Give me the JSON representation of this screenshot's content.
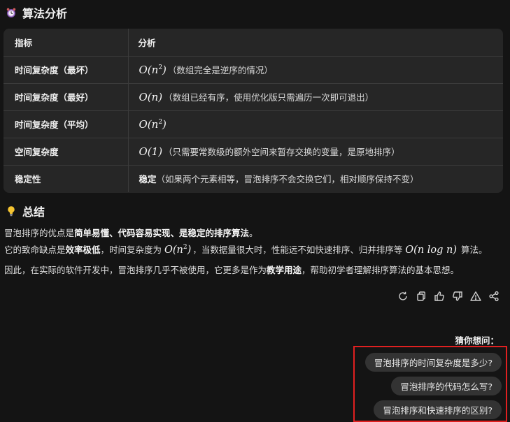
{
  "analysis": {
    "title": "算法分析",
    "table": {
      "headers": [
        "指标",
        "分析"
      ],
      "rows": [
        {
          "metric": "时间复杂度（最坏）",
          "math": "O(n",
          "sup": "2",
          "math_end": ")",
          "bold": "",
          "desc": "（数组完全是逆序的情况）"
        },
        {
          "metric": "时间复杂度（最好）",
          "math": "O(n)",
          "sup": "",
          "math_end": "",
          "bold": "",
          "desc": "（数组已经有序，使用优化版只需遍历一次即可退出）"
        },
        {
          "metric": "时间复杂度（平均）",
          "math": "O(n",
          "sup": "2",
          "math_end": ")",
          "bold": "",
          "desc": ""
        },
        {
          "metric": "空间复杂度",
          "math": "O(1)",
          "sup": "",
          "math_end": "",
          "bold": "",
          "desc": "（只需要常数级的额外空间来暂存交换的变量，是原地排序）"
        },
        {
          "metric": "稳定性",
          "math": "",
          "sup": "",
          "math_end": "",
          "bold": "稳定",
          "desc": "（如果两个元素相等，冒泡排序不会交换它们，相对顺序保持不变）"
        }
      ]
    }
  },
  "summary": {
    "title": "总结",
    "p1": {
      "a": "冒泡排序的优点是",
      "b": "简单易懂、代码容易实现、是稳定的排序算法",
      "c": "。"
    },
    "p2": {
      "a": "它的致命缺点是",
      "b": "效率极低",
      "c": "，时间复杂度为 ",
      "math1": "O(n",
      "sup1": "2",
      "math1_end": ")",
      "d": "，当数据量很大时，性能远不如快速排序、归并排序等 ",
      "math2": "O(n log n)",
      "e": " 算法。"
    },
    "p3": {
      "a": "因此，在实际的软件开发中，冒泡排序几乎不被使用，它更多是作为",
      "b": "教学用途",
      "c": "，帮助初学者理解排序算法的基本思想。"
    }
  },
  "actions": [
    "refresh-icon",
    "copy-icon",
    "thumbs-up-icon",
    "thumbs-down-icon",
    "warning-icon",
    "share-icon"
  ],
  "suggestions": {
    "label": "猜你想问：",
    "items": [
      "冒泡排序的时间复杂度是多少?",
      "冒泡排序的代码怎么写?",
      "冒泡排序和快速排序的区别?"
    ]
  },
  "colors": {
    "background": "#141414",
    "table_bg": "#262626",
    "chip_bg": "#333333",
    "highlight_border": "#e02020"
  }
}
